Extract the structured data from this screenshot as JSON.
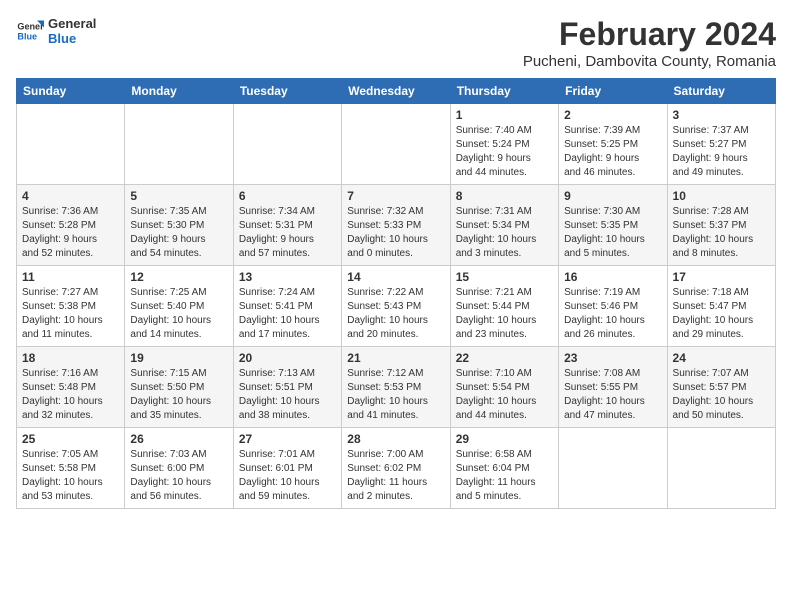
{
  "logo": {
    "text_general": "General",
    "text_blue": "Blue"
  },
  "header": {
    "title": "February 2024",
    "subtitle": "Pucheni, Dambovita County, Romania"
  },
  "days_of_week": [
    "Sunday",
    "Monday",
    "Tuesday",
    "Wednesday",
    "Thursday",
    "Friday",
    "Saturday"
  ],
  "weeks": [
    [
      {
        "day": "",
        "info": ""
      },
      {
        "day": "",
        "info": ""
      },
      {
        "day": "",
        "info": ""
      },
      {
        "day": "",
        "info": ""
      },
      {
        "day": "1",
        "info": "Sunrise: 7:40 AM\nSunset: 5:24 PM\nDaylight: 9 hours\nand 44 minutes."
      },
      {
        "day": "2",
        "info": "Sunrise: 7:39 AM\nSunset: 5:25 PM\nDaylight: 9 hours\nand 46 minutes."
      },
      {
        "day": "3",
        "info": "Sunrise: 7:37 AM\nSunset: 5:27 PM\nDaylight: 9 hours\nand 49 minutes."
      }
    ],
    [
      {
        "day": "4",
        "info": "Sunrise: 7:36 AM\nSunset: 5:28 PM\nDaylight: 9 hours\nand 52 minutes."
      },
      {
        "day": "5",
        "info": "Sunrise: 7:35 AM\nSunset: 5:30 PM\nDaylight: 9 hours\nand 54 minutes."
      },
      {
        "day": "6",
        "info": "Sunrise: 7:34 AM\nSunset: 5:31 PM\nDaylight: 9 hours\nand 57 minutes."
      },
      {
        "day": "7",
        "info": "Sunrise: 7:32 AM\nSunset: 5:33 PM\nDaylight: 10 hours\nand 0 minutes."
      },
      {
        "day": "8",
        "info": "Sunrise: 7:31 AM\nSunset: 5:34 PM\nDaylight: 10 hours\nand 3 minutes."
      },
      {
        "day": "9",
        "info": "Sunrise: 7:30 AM\nSunset: 5:35 PM\nDaylight: 10 hours\nand 5 minutes."
      },
      {
        "day": "10",
        "info": "Sunrise: 7:28 AM\nSunset: 5:37 PM\nDaylight: 10 hours\nand 8 minutes."
      }
    ],
    [
      {
        "day": "11",
        "info": "Sunrise: 7:27 AM\nSunset: 5:38 PM\nDaylight: 10 hours\nand 11 minutes."
      },
      {
        "day": "12",
        "info": "Sunrise: 7:25 AM\nSunset: 5:40 PM\nDaylight: 10 hours\nand 14 minutes."
      },
      {
        "day": "13",
        "info": "Sunrise: 7:24 AM\nSunset: 5:41 PM\nDaylight: 10 hours\nand 17 minutes."
      },
      {
        "day": "14",
        "info": "Sunrise: 7:22 AM\nSunset: 5:43 PM\nDaylight: 10 hours\nand 20 minutes."
      },
      {
        "day": "15",
        "info": "Sunrise: 7:21 AM\nSunset: 5:44 PM\nDaylight: 10 hours\nand 23 minutes."
      },
      {
        "day": "16",
        "info": "Sunrise: 7:19 AM\nSunset: 5:46 PM\nDaylight: 10 hours\nand 26 minutes."
      },
      {
        "day": "17",
        "info": "Sunrise: 7:18 AM\nSunset: 5:47 PM\nDaylight: 10 hours\nand 29 minutes."
      }
    ],
    [
      {
        "day": "18",
        "info": "Sunrise: 7:16 AM\nSunset: 5:48 PM\nDaylight: 10 hours\nand 32 minutes."
      },
      {
        "day": "19",
        "info": "Sunrise: 7:15 AM\nSunset: 5:50 PM\nDaylight: 10 hours\nand 35 minutes."
      },
      {
        "day": "20",
        "info": "Sunrise: 7:13 AM\nSunset: 5:51 PM\nDaylight: 10 hours\nand 38 minutes."
      },
      {
        "day": "21",
        "info": "Sunrise: 7:12 AM\nSunset: 5:53 PM\nDaylight: 10 hours\nand 41 minutes."
      },
      {
        "day": "22",
        "info": "Sunrise: 7:10 AM\nSunset: 5:54 PM\nDaylight: 10 hours\nand 44 minutes."
      },
      {
        "day": "23",
        "info": "Sunrise: 7:08 AM\nSunset: 5:55 PM\nDaylight: 10 hours\nand 47 minutes."
      },
      {
        "day": "24",
        "info": "Sunrise: 7:07 AM\nSunset: 5:57 PM\nDaylight: 10 hours\nand 50 minutes."
      }
    ],
    [
      {
        "day": "25",
        "info": "Sunrise: 7:05 AM\nSunset: 5:58 PM\nDaylight: 10 hours\nand 53 minutes."
      },
      {
        "day": "26",
        "info": "Sunrise: 7:03 AM\nSunset: 6:00 PM\nDaylight: 10 hours\nand 56 minutes."
      },
      {
        "day": "27",
        "info": "Sunrise: 7:01 AM\nSunset: 6:01 PM\nDaylight: 10 hours\nand 59 minutes."
      },
      {
        "day": "28",
        "info": "Sunrise: 7:00 AM\nSunset: 6:02 PM\nDaylight: 11 hours\nand 2 minutes."
      },
      {
        "day": "29",
        "info": "Sunrise: 6:58 AM\nSunset: 6:04 PM\nDaylight: 11 hours\nand 5 minutes."
      },
      {
        "day": "",
        "info": ""
      },
      {
        "day": "",
        "info": ""
      }
    ]
  ]
}
